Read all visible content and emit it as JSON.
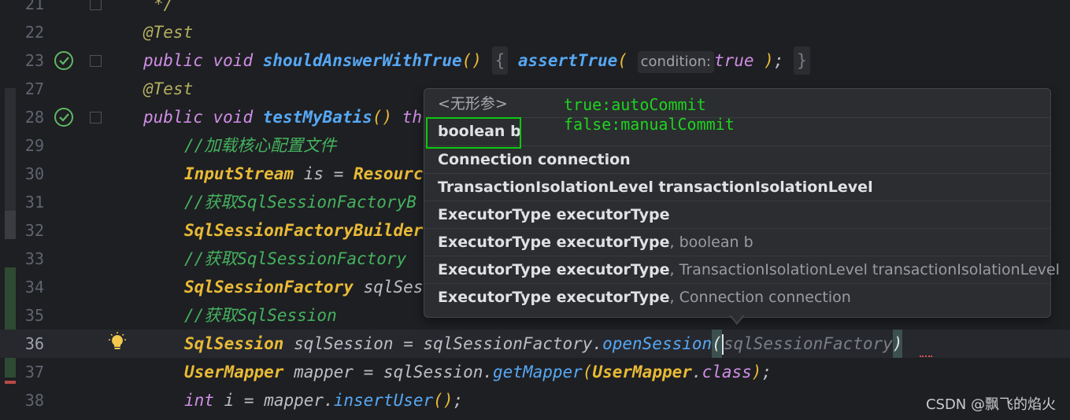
{
  "lines": [
    {
      "num": "21"
    },
    {
      "num": "22",
      "ann": "@Test"
    },
    {
      "num": "23",
      "kw1": "public",
      "kw2": "void",
      "fn": "shouldAnswerWithTrue",
      "call": "assertTrue",
      "hint": "condition:",
      "val": "true"
    },
    {
      "num": "27",
      "ann": "@Test"
    },
    {
      "num": "28",
      "kw1": "public",
      "kw2": "void",
      "fn": "testMyBatis",
      "tail": "th"
    },
    {
      "num": "29",
      "comment": "//加载核心配置文件"
    },
    {
      "num": "30",
      "type": "InputStream",
      "var": "is",
      "eq": "=",
      "tail": "Resourc"
    },
    {
      "num": "31",
      "comment": "//获取SqlSessionFactoryB"
    },
    {
      "num": "32",
      "type": "SqlSessionFactoryBuilder"
    },
    {
      "num": "33",
      "comment": "//获取SqlSessionFactory"
    },
    {
      "num": "34",
      "type": "SqlSessionFactory",
      "var": "sqlSes"
    },
    {
      "num": "35",
      "comment": "//获取SqlSession"
    },
    {
      "num": "36",
      "type": "SqlSession",
      "var": "sqlSession",
      "eq": "=",
      "obj": "sqlSessionFactory",
      "method": "openSession",
      "arg": "sqlSessionFactory"
    },
    {
      "num": "37",
      "type": "UserMapper",
      "var": "mapper",
      "eq": "=",
      "obj": "sqlSession",
      "method": "getMapper",
      "argtype": "UserMapper",
      "argkw": "class"
    },
    {
      "num": "38",
      "kw": "int",
      "var": "i",
      "eq": "=",
      "obj": "mapper",
      "method": "insertUser"
    }
  ],
  "popup": {
    "header": "<无形参>",
    "items": [
      {
        "main": "boolean b",
        "rest": ""
      },
      {
        "main": "Connection connection",
        "rest": ""
      },
      {
        "main": "TransactionIsolationLevel transactionIsolationLevel",
        "rest": ""
      },
      {
        "main": "ExecutorType executorType",
        "rest": ""
      },
      {
        "main": "ExecutorType executorType",
        "rest": ", boolean b"
      },
      {
        "main": "ExecutorType executorType",
        "rest": ", TransactionIsolationLevel transactionIsolationLevel"
      },
      {
        "main": "ExecutorType executorType",
        "rest": ", Connection connection"
      }
    ]
  },
  "annotation_note": {
    "line1": "true:autoCommit",
    "line2": "false:manualCommit"
  },
  "watermark": "CSDN @飘飞的焰火",
  "colors": {
    "highlight_box": "#0ec80e",
    "note_text": "#1fd31f",
    "background": "#1e1f22"
  }
}
